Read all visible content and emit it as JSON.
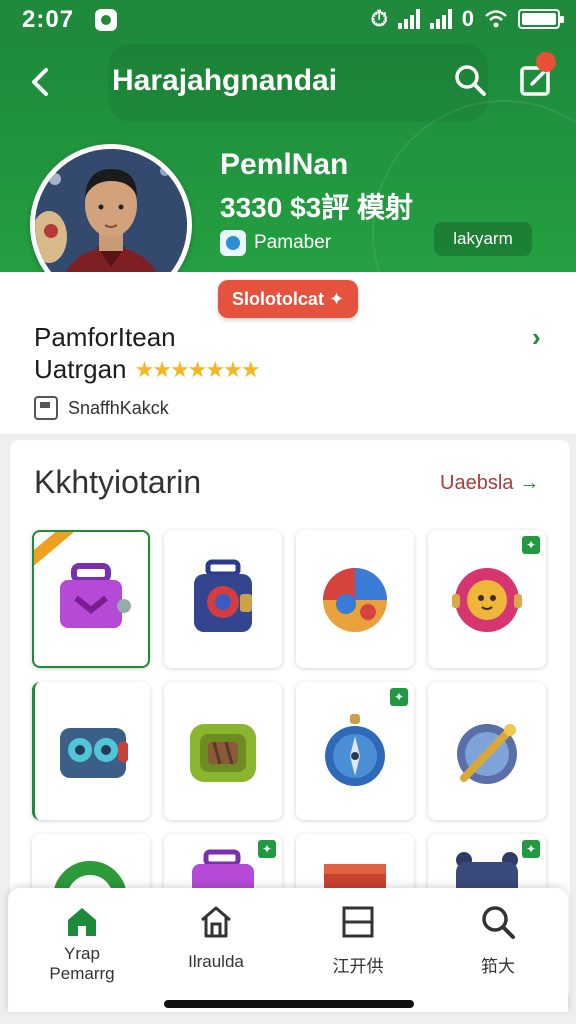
{
  "status_bar": {
    "time": "2:07",
    "battery_label": "0"
  },
  "header": {
    "title": "Harajahgnandai",
    "profile_name": "PemlNan",
    "profile_stats": "3330 $3評  模射",
    "member_label": "Pamaber",
    "tag_label": "lakyarm"
  },
  "info_card": {
    "badge_label": "Slolotolcat",
    "title": "PamforItean",
    "subtitle": "Uatrgan",
    "rating": 5,
    "tag": "SnaffhKakck"
  },
  "collection": {
    "title": "Kkhtyiotarin",
    "see_all": "Uaebsla",
    "items": [
      {
        "name": "purple-lunchbox",
        "selected": true,
        "badge": false
      },
      {
        "name": "blue-robot-box",
        "selected": false,
        "badge": false
      },
      {
        "name": "rainbow-orb",
        "selected": false,
        "badge": false
      },
      {
        "name": "pink-cat-orb",
        "selected": false,
        "badge": true
      },
      {
        "name": "teal-binocular-bot",
        "selected": false,
        "badge": false
      },
      {
        "name": "green-chest",
        "selected": false,
        "badge": false
      },
      {
        "name": "blue-compass",
        "selected": false,
        "badge": true
      },
      {
        "name": "gold-key-compass",
        "selected": false,
        "badge": false
      },
      {
        "name": "green-ring",
        "selected": false,
        "badge": false
      },
      {
        "name": "purple-box",
        "selected": false,
        "badge": true
      },
      {
        "name": "red-crate",
        "selected": false,
        "badge": false
      },
      {
        "name": "navy-bot",
        "selected": false,
        "badge": true
      }
    ]
  },
  "bottom_nav": [
    {
      "label": "Yrap\nPemarrg",
      "icon": "home-icon",
      "active": true
    },
    {
      "label": "Ilraulda",
      "icon": "house-outline-icon",
      "active": false
    },
    {
      "label": "江开供",
      "icon": "list-box-icon",
      "active": false
    },
    {
      "label": "筘大",
      "icon": "search-icon",
      "active": false
    }
  ],
  "colors": {
    "brand_green": "#1f8a3c",
    "accent_red": "#e5533f",
    "star": "#f2b722"
  }
}
